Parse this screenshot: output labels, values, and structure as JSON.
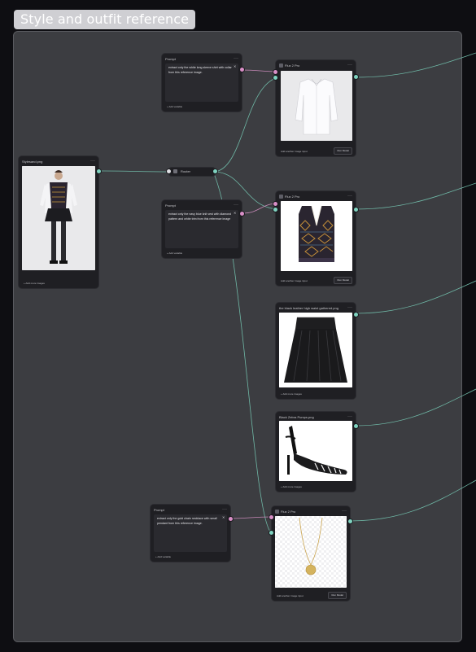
{
  "group": {
    "title": "Style and outfit reference"
  },
  "router": {
    "label": "Router"
  },
  "source_node": {
    "filename": "Stylesand.png",
    "footer": "+ Add more images"
  },
  "prompt_nodes": [
    {
      "title": "Prompt",
      "text": "extract only the white long sleeve shirt with collar from this reference image.",
      "footer": "+ Add variable"
    },
    {
      "title": "Prompt",
      "text": "extract only the navy blue knit vest with diamond pattern and white trim from this reference image",
      "footer": "+ Add variable"
    },
    {
      "title": "Prompt",
      "text": "extract only the gold chain necklace with small pendant from this reference image.",
      "footer": "+ Add variable"
    }
  ],
  "model_nodes": [
    {
      "title": "Flux 2 Pro",
      "footer": "Add another image input",
      "run_label": "Run Model"
    },
    {
      "title": "Flux 2 Pro",
      "footer": "Add another image input",
      "run_label": "Run Model"
    },
    {
      "title": "Flux 2 Pro",
      "footer": "Add another image input",
      "run_label": "Run Model"
    }
  ],
  "image_nodes": [
    {
      "filename": "the black leather high waist gathered.png",
      "footer": "+ Add more images"
    },
    {
      "filename": "Black Zebra Pumps.png",
      "footer": "+ Add more images"
    }
  ],
  "colors": {
    "canvas": "#3c3d41",
    "background": "#0e0e12",
    "wire_teal": "#6fb8a6",
    "wire_pink": "#c889b8",
    "node": "#1f1f23"
  },
  "icons": [
    "more-dots-icon",
    "close-icon",
    "model-icon",
    "router-icon"
  ]
}
